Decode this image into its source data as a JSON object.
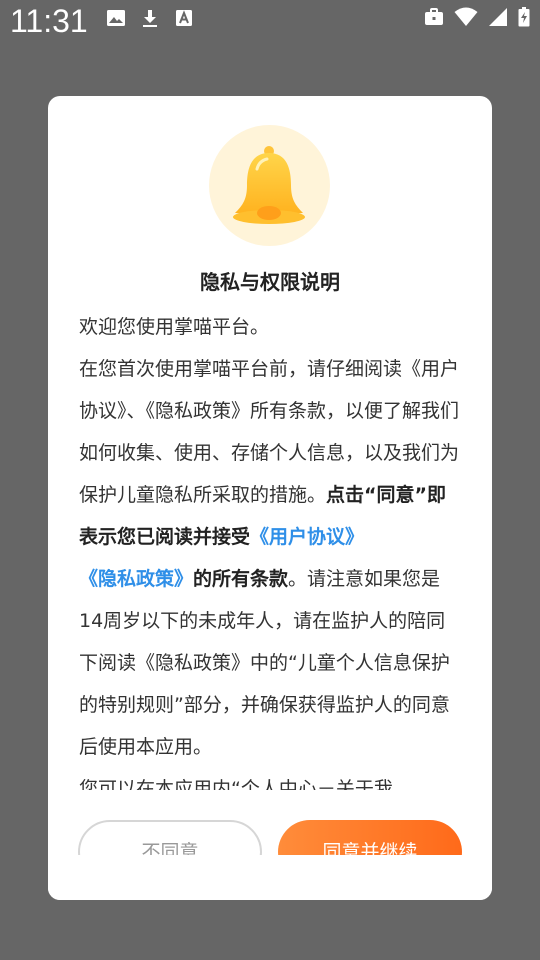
{
  "status_bar": {
    "time": "11:31",
    "left_icons": [
      "image-icon",
      "download-icon",
      "font-icon"
    ],
    "right_icons": [
      "briefcase-icon",
      "wifi-icon",
      "signal-icon",
      "battery-icon"
    ]
  },
  "dialog": {
    "icon": "bell-icon",
    "title": "隐私与权限说明",
    "paragraph1": "欢迎您使用掌喵平台。",
    "paragraph2_intro": " 在您首次使用掌喵平台前，请仔细阅读《用户协议》、《隐私政策》所有条款，以便了解我们如何收集、使用、存储个人信息，以及我们为保护儿童隐私所采取的措施。",
    "paragraph2_bold": "点击“同意”即表示您已阅读并接受",
    "link_user_agreement": "《用户协议》",
    "link_privacy_policy": "《隐私政策》",
    "paragraph2_bold_tail": "的所有条款",
    "paragraph2_end": "。请注意如果您是14周岁以下的未成年人，请在监护人的陪同下阅读《隐私政策》中的“儿童个人信息保护的特别规则”部分，并确保获得监护人的同意后使用本应用。",
    "paragraph3": "您可以在本应用内“个人中心－关于我",
    "disagree_label": "不同意",
    "agree_label": "同意并继续"
  },
  "colors": {
    "overlay": "#666666",
    "link": "#2f8fe8",
    "accent": "#ff7a28",
    "bell": "#ffc83a"
  }
}
